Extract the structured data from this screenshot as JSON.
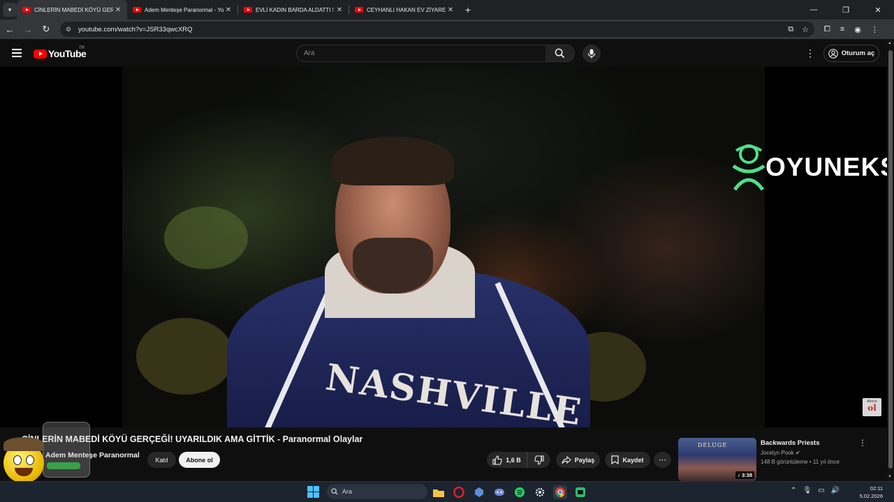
{
  "browser": {
    "tabs": [
      {
        "title": "CİNLERİN MABEDİ KÖYÜ GERÇ",
        "active": true
      },
      {
        "title": "Adem Menteşe Paranormal - Yo",
        "active": false
      },
      {
        "title": "EVLİ KADIN BARDA ALDATTI !",
        "active": false
      },
      {
        "title": "CEYHANLI HAKAN EV ZİYARETİ",
        "active": false
      }
    ],
    "url": "youtube.com/watch?v=JSR33qwcXRQ"
  },
  "youtube": {
    "logo_text": "YouTube",
    "country_code": "TR",
    "search_placeholder": "Ara",
    "signin_label": "Oturum aç"
  },
  "player": {
    "watermark_text": "OYUNEKS",
    "jersey_text": "NASHVILLE",
    "badge_top": "Abone",
    "badge_bottom": "ol"
  },
  "video": {
    "title": "CİNLERİN MABEDİ KÖYÜ GERÇEĞİ! UYARILDIK AMA GİTTİK - Paranormal Olaylar",
    "channel": "Adem Menteşe Paranormal",
    "join_label": "Katıl",
    "subscribe_label": "Abone ol",
    "likes": "1,6 B",
    "share_label": "Paylaş",
    "save_label": "Kaydet"
  },
  "recommendation": {
    "title": "Backwards Priests",
    "channel": "Jocelyn Pook",
    "stats": "148 B görüntüleme • 11 yıl önce",
    "duration": "3:38",
    "thumb_text": "DELUGE"
  },
  "taskbar": {
    "search_placeholder": "Ara",
    "time": "02:11",
    "date": "5.02.2026"
  },
  "colors": {
    "accent_red": "#ff0000",
    "background": "#0f0f0f",
    "watermark_green": "#4fe08a"
  }
}
